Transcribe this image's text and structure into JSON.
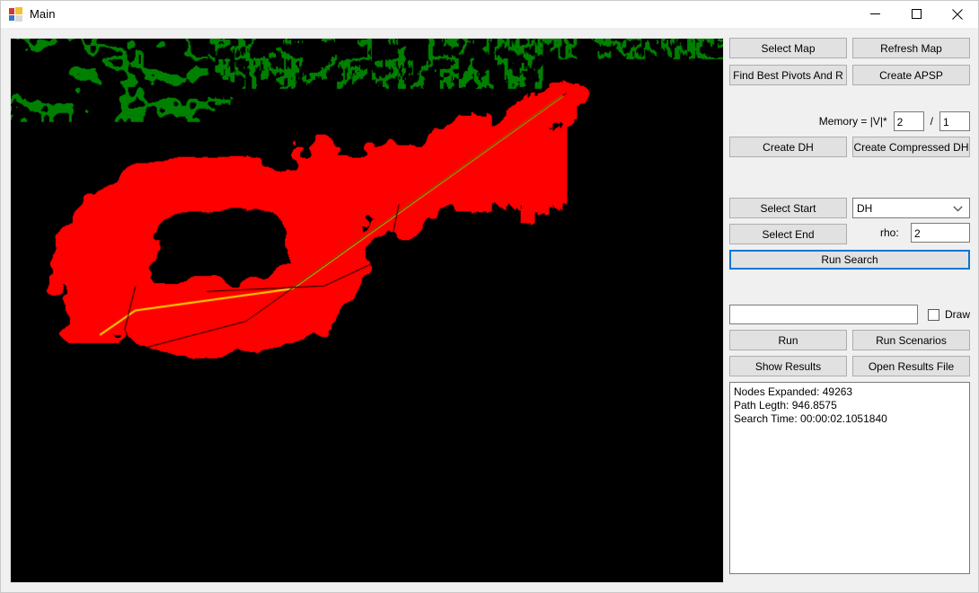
{
  "window": {
    "title": "Main",
    "icon": "app-window-icon",
    "controls": {
      "minimize": "minimize-icon",
      "maximize": "maximize-icon",
      "close": "close-icon"
    }
  },
  "colors": {
    "map_background": "#000000",
    "map_obstacle": "#008000",
    "map_expanded": "#FF0000",
    "map_free": "#FFFFFF",
    "map_path": "#FFD800",
    "focus_border": "#0078D7",
    "button_face": "#E1E1E1",
    "form_face": "#F0F0F0"
  },
  "map": {
    "name": "map-render-panel"
  },
  "controls": {
    "select_map": "Select Map",
    "refresh_map": "Refresh Map",
    "find_best_pivots": "Find Best Pivots And R",
    "create_apsp": "Create APSP",
    "memory_label": "Memory = |V|*",
    "memory_numerator": "2",
    "memory_denominator": "1",
    "memory_separator": "/",
    "create_dh": "Create DH",
    "create_compressed_dh": "Create Compressed DH",
    "select_start": "Select Start",
    "select_end": "Select End",
    "heuristic_selected": "DH",
    "heuristic_options": [
      "DH"
    ],
    "heuristic_arrow": "chevron-down-icon",
    "rho_label": "rho:",
    "rho_value": "2",
    "run_search": "Run Search",
    "free_text_value": "",
    "draw_label": "Draw",
    "draw_checked": false,
    "run": "Run",
    "run_scenarios": "Run Scenarios",
    "show_results": "Show Results",
    "open_results_file": "Open Results File"
  },
  "results": {
    "line1": "Nodes Expanded: 49263",
    "line2": "Path Legth: 946.8575",
    "line3": "Search Time: 00:00:02.1051840"
  }
}
